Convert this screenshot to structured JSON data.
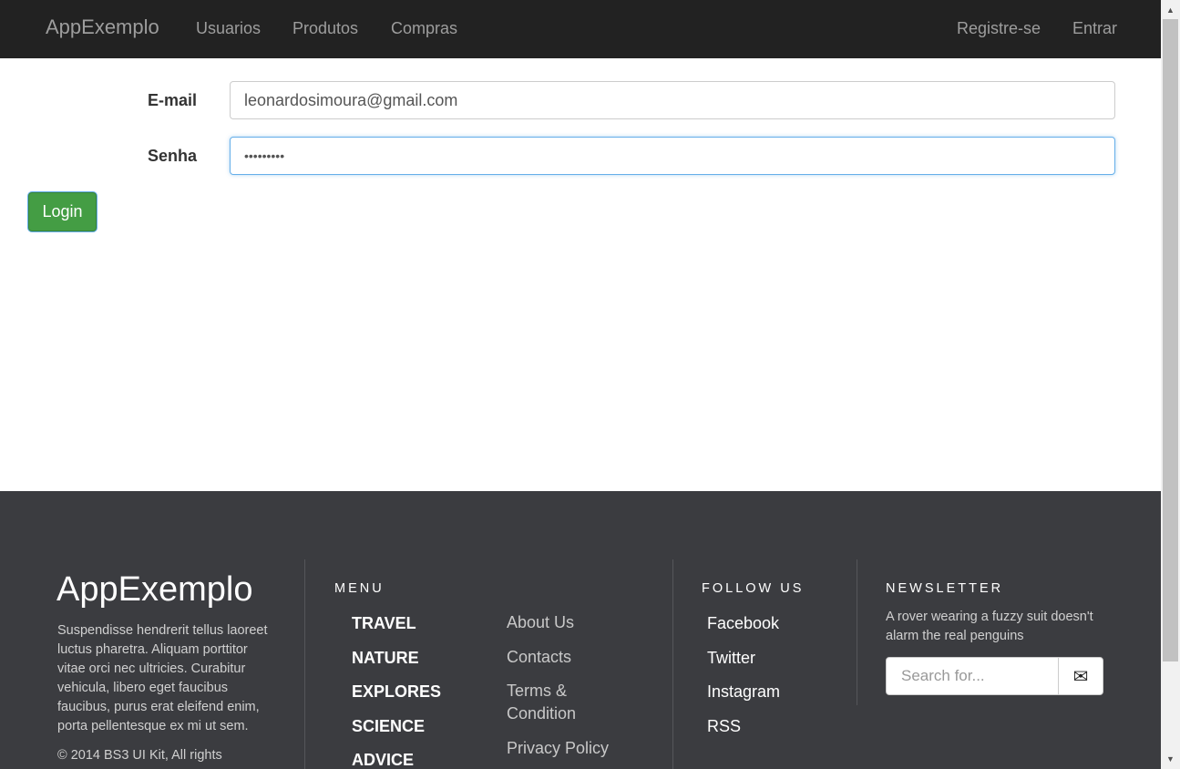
{
  "navbar": {
    "brand": "AppExemplo",
    "links": [
      "Usuarios",
      "Produtos",
      "Compras"
    ],
    "right_links": [
      "Registre-se",
      "Entrar"
    ]
  },
  "form": {
    "email_label": "E-mail",
    "email_value": "leonardosimoura@gmail.com",
    "password_label": "Senha",
    "password_value": "•••••••••",
    "login_label": "Login"
  },
  "footer": {
    "brand": "AppExemplo",
    "description": "Suspendisse hendrerit tellus laoreet luctus pharetra. Aliquam porttitor vitae orci nec ultricies. Curabitur vehicula, libero eget faucibus faucibus, purus erat eleifend enim, porta pellentesque ex mi ut sem.",
    "copyright": "© 2014 BS3 UI Kit, All rights",
    "menu_heading": "MENU",
    "menu_bold": [
      "TRAVEL",
      "NATURE",
      "EXPLORES",
      "SCIENCE",
      "ADVICE"
    ],
    "menu_links": [
      "About Us",
      "Contacts",
      "Terms & Condition",
      "Privacy Policy"
    ],
    "follow_heading": "FOLLOW US",
    "social": [
      "Facebook",
      "Twitter",
      "Instagram",
      "RSS"
    ],
    "newsletter_heading": "NEWSLETTER",
    "newsletter_text": "A rover wearing a fuzzy suit doesn't alarm the real penguins",
    "search_placeholder": "Search for...",
    "send_icon": "envelope-icon"
  },
  "colors": {
    "navbar_bg": "#222222",
    "footer_bg": "#3b3c40",
    "login_button": "#449d44"
  }
}
